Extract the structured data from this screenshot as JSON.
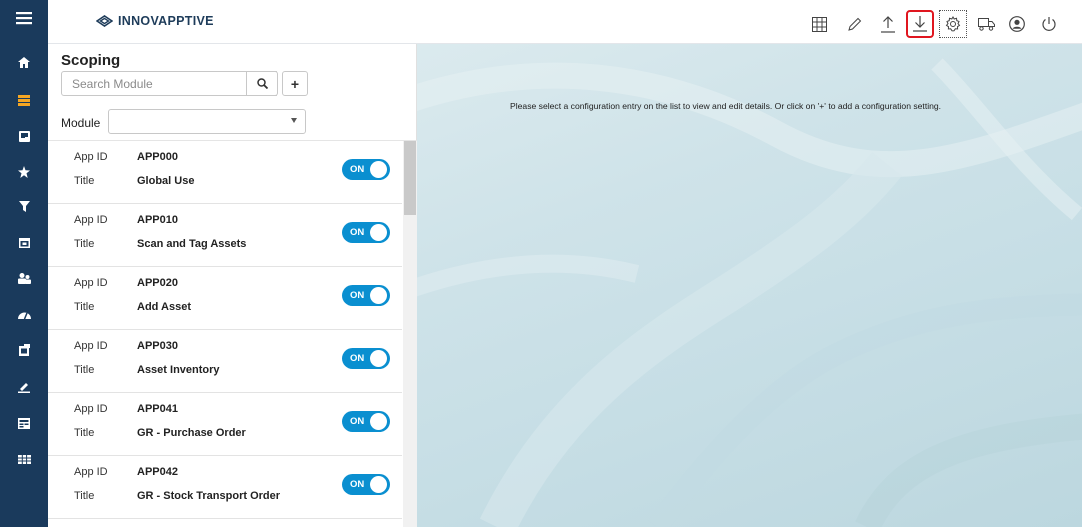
{
  "brand": {
    "name": "INNOVAPPTIVE"
  },
  "rail": {
    "items": [
      {
        "icon": "menu-icon"
      },
      {
        "icon": "home-icon"
      },
      {
        "icon": "list-icon",
        "active": true
      },
      {
        "icon": "tag-icon"
      },
      {
        "icon": "star-icon"
      },
      {
        "icon": "filter-icon"
      },
      {
        "icon": "calendar-icon"
      },
      {
        "icon": "users-icon"
      },
      {
        "icon": "dashboard-icon"
      },
      {
        "icon": "clipboard-icon"
      },
      {
        "icon": "edit-icon"
      },
      {
        "icon": "report-icon"
      },
      {
        "icon": "table-icon"
      }
    ]
  },
  "toolbar": {
    "items": [
      "grid-icon",
      "pencil-icon",
      "upload-icon",
      "download-icon",
      "settings-icon",
      "truck-icon",
      "user-icon",
      "power-icon"
    ],
    "highlighted": "download-icon"
  },
  "panel": {
    "title": "Scoping",
    "search_placeholder": "Search Module",
    "add_label": "+",
    "module_label": "Module",
    "module_value": ""
  },
  "list": {
    "key_app_id": "App ID",
    "key_title": "Title",
    "toggle_label": "ON",
    "items": [
      {
        "app_id": "APP000",
        "title": "Global Use",
        "enabled": true
      },
      {
        "app_id": "APP010",
        "title": "Scan and Tag Assets",
        "enabled": true
      },
      {
        "app_id": "APP020",
        "title": "Add Asset",
        "enabled": true
      },
      {
        "app_id": "APP030",
        "title": "Asset Inventory",
        "enabled": true
      },
      {
        "app_id": "APP041",
        "title": "GR - Purchase Order",
        "enabled": true
      },
      {
        "app_id": "APP042",
        "title": "GR - Stock Transport Order",
        "enabled": true
      }
    ]
  },
  "main": {
    "message": "Please select a configuration entry on the list to view and edit details. Or click on '+' to add a configuration setting."
  },
  "colors": {
    "rail": "#1a3a5c",
    "accent": "#0a8fd0",
    "highlight": "#e0161f",
    "active_icon": "#f5a623"
  }
}
